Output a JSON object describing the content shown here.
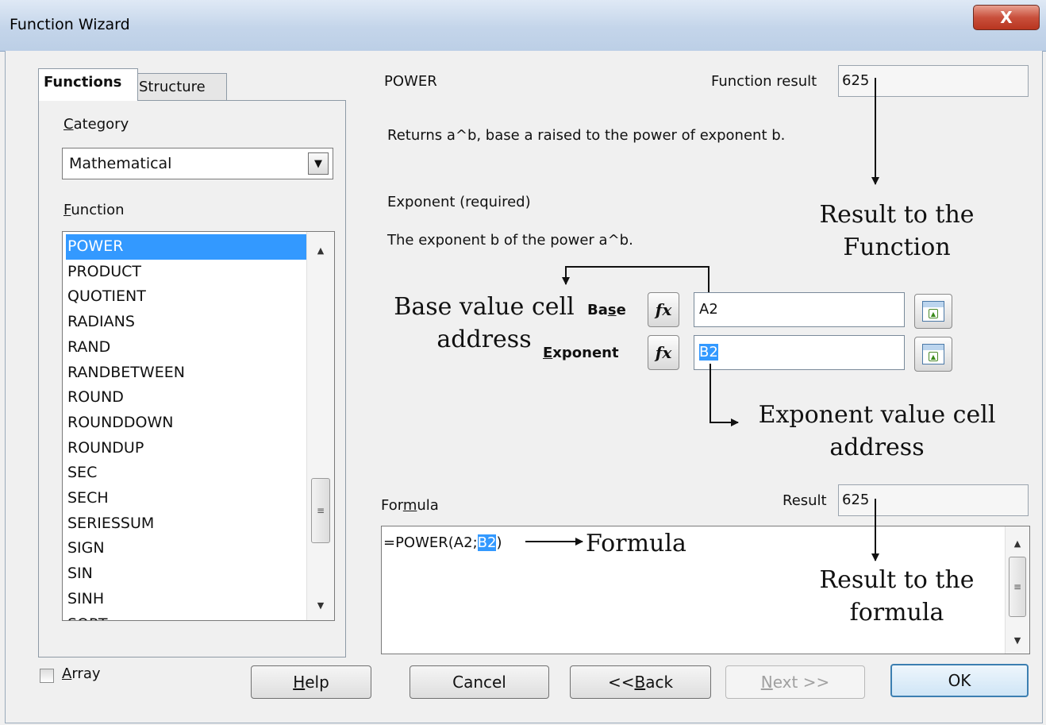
{
  "window": {
    "title": "Function Wizard",
    "close_glyph": "X"
  },
  "tabs": [
    {
      "label": "Functions",
      "active": true
    },
    {
      "label": "Structure",
      "active": false
    }
  ],
  "category": {
    "label_first": "C",
    "label_rest": "ategory",
    "selected": "Mathematical"
  },
  "function_list": {
    "label_first": "F",
    "label_rest": "unction",
    "items": [
      "POWER",
      "PRODUCT",
      "QUOTIENT",
      "RADIANS",
      "RAND",
      "RANDBETWEEN",
      "ROUND",
      "ROUNDDOWN",
      "ROUNDUP",
      "SEC",
      "SECH",
      "SERIESSUM",
      "SIGN",
      "SIN",
      "SINH",
      "SQRT"
    ],
    "selected_index": 0
  },
  "function_info": {
    "name": "POWER",
    "result_label": "Function result",
    "result_value": "625",
    "description": "Returns a^b, base a raised to the power of exponent b.",
    "param_title": "Exponent (required)",
    "param_description": "The exponent b of the power a^b."
  },
  "args": [
    {
      "label_pre": "Ba",
      "label_under": "s",
      "label_post": "e",
      "value": "A2",
      "fx": "fx"
    },
    {
      "label_pre": "",
      "label_under": "E",
      "label_post": "xponent",
      "value": "B2",
      "fx": "fx"
    }
  ],
  "formula": {
    "label_pre": "For",
    "label_under": "m",
    "label_post": "ula",
    "result_label": "Result",
    "result_value": "625",
    "text_prefix": "=POWER(A2;",
    "text_selected": "B2",
    "text_suffix": ")"
  },
  "array_checkbox": {
    "label_first": "A",
    "label_rest": "rray",
    "checked": false
  },
  "buttons": {
    "help": {
      "first": "H",
      "rest": "elp"
    },
    "cancel": "Cancel",
    "back": {
      "pre": "<< ",
      "under": "B",
      "post": "ack"
    },
    "next": {
      "under": "N",
      "post": "ext >>"
    },
    "ok": "OK"
  },
  "annotations": {
    "result_function": [
      "Result  to the",
      "Function"
    ],
    "base_cell": [
      "Base value cell",
      "address"
    ],
    "exponent_cell": [
      "Exponent value cell",
      "address"
    ],
    "formula": "Formula",
    "result_formula": [
      "Result to the",
      "formula"
    ]
  }
}
